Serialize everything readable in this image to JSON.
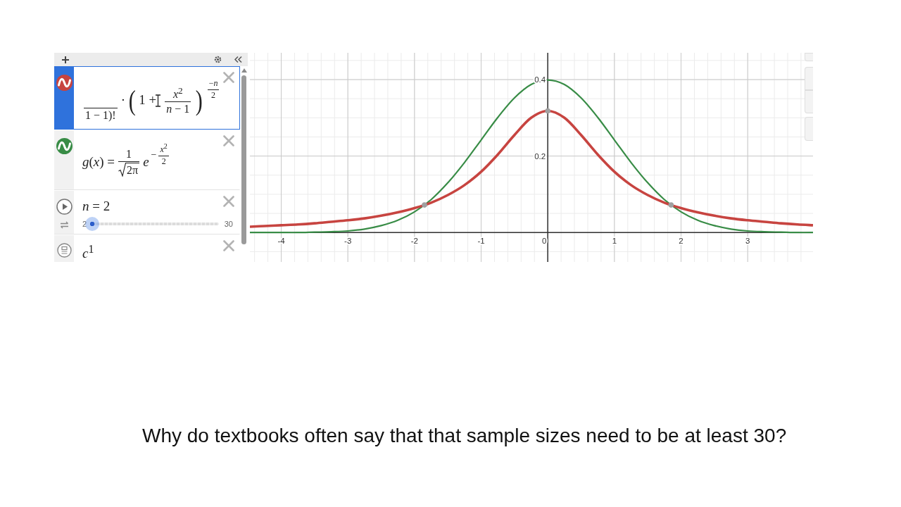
{
  "expression_panel": {
    "expressions": [
      {
        "kind": "formula",
        "selected": true,
        "color": "#c74440",
        "tokens": [
          {
            "kind": "bar",
            "text": "1 − 1)!"
          },
          {
            "kind": "text",
            "text": "·"
          },
          {
            "kind": "paren",
            "text": "("
          },
          {
            "kind": "text",
            "text": "1 +"
          },
          {
            "kind": "cursor"
          },
          {
            "kind": "frac",
            "num": "*x*$^{2}$",
            "den": "*n* − 1"
          },
          {
            "kind": "paren",
            "text": ")"
          },
          {
            "kind": "power",
            "num": "−*n*",
            "den": "2"
          }
        ]
      },
      {
        "kind": "formula",
        "selected": false,
        "color": "#388c46",
        "tokens": [
          {
            "kind": "text",
            "text": "*g*(*x*) ="
          },
          {
            "kind": "frac",
            "num": "1",
            "den": "2π",
            "root": true
          },
          {
            "kind": "text",
            "text": "*e*"
          },
          {
            "kind": "power",
            "sign": "−",
            "num": "*x*$^{2}$",
            "den": "2"
          }
        ]
      },
      {
        "kind": "slider",
        "selected": false,
        "tokens": [
          {
            "kind": "text",
            "text": "*n* = 2"
          }
        ],
        "min": "2",
        "max": "30",
        "level": 0
      },
      {
        "kind": "other",
        "selected": false,
        "tokens": [
          {
            "kind": "text",
            "text": "*c*$^{1}$"
          }
        ]
      }
    ]
  },
  "graph": {
    "chart_data": [
      {
        "type": "line",
        "xlim": [
          -4.47,
          3.98
        ],
        "ylim": [
          -0.077,
          0.47
        ],
        "xticks": [
          -4,
          -3,
          -2,
          -1,
          0,
          1,
          2,
          3
        ],
        "yticks": [
          0.2,
          0.4
        ],
        "grid": true,
        "series": [
          {
            "color": "#388c46",
            "x": [
              -4.47,
              -4.25,
              -4,
              -3.75,
              -3.5,
              -3.25,
              -3,
              -2.75,
              -2.5,
              -2.25,
              -2,
              -1.75,
              -1.5,
              -1.25,
              -1,
              -0.75,
              -0.5,
              -0.25,
              0,
              0.25,
              0.5,
              0.75,
              1,
              1.25,
              1.5,
              1.75,
              2,
              2.25,
              2.5,
              2.75,
              3,
              3.25,
              3.5,
              3.75,
              3.98
            ],
            "values": [
              0,
              0,
              0,
              0,
              0.001,
              0.002,
              0.004,
              0.009,
              0.018,
              0.032,
              0.054,
              0.086,
              0.13,
              0.183,
              0.242,
              0.301,
              0.352,
              0.387,
              0.399,
              0.387,
              0.352,
              0.301,
              0.242,
              0.183,
              0.13,
              0.086,
              0.054,
              0.032,
              0.018,
              0.009,
              0.004,
              0.002,
              0.001,
              0,
              0
            ]
          },
          {
            "color": "#c74440",
            "x": [
              -4.47,
              -4.25,
              -4,
              -3.75,
              -3.5,
              -3.25,
              -3,
              -2.75,
              -2.5,
              -2.25,
              -2,
              -1.75,
              -1.5,
              -1.25,
              -1,
              -0.75,
              -0.5,
              -0.25,
              0,
              0.25,
              0.5,
              0.75,
              1,
              1.25,
              1.5,
              1.75,
              2,
              2.25,
              2.5,
              2.75,
              3,
              3.25,
              3.5,
              3.75,
              3.98
            ],
            "values": [
              0.015,
              0.017,
              0.019,
              0.021,
              0.024,
              0.028,
              0.032,
              0.037,
              0.044,
              0.053,
              0.064,
              0.078,
              0.098,
              0.124,
              0.159,
              0.204,
              0.255,
              0.3,
              0.318,
              0.3,
              0.255,
              0.204,
              0.159,
              0.124,
              0.098,
              0.078,
              0.064,
              0.053,
              0.044,
              0.037,
              0.032,
              0.028,
              0.024,
              0.021,
              0.019
            ]
          },
          {
            "type": "scatter",
            "color": "#a0a0a0",
            "x": [
              -1.85,
              0,
              1.85
            ],
            "values": [
              0.072,
              0.318,
              0.072
            ]
          }
        ]
      }
    ]
  },
  "question": "Why do textbooks often say that that sample sizes need to be at least 30?"
}
